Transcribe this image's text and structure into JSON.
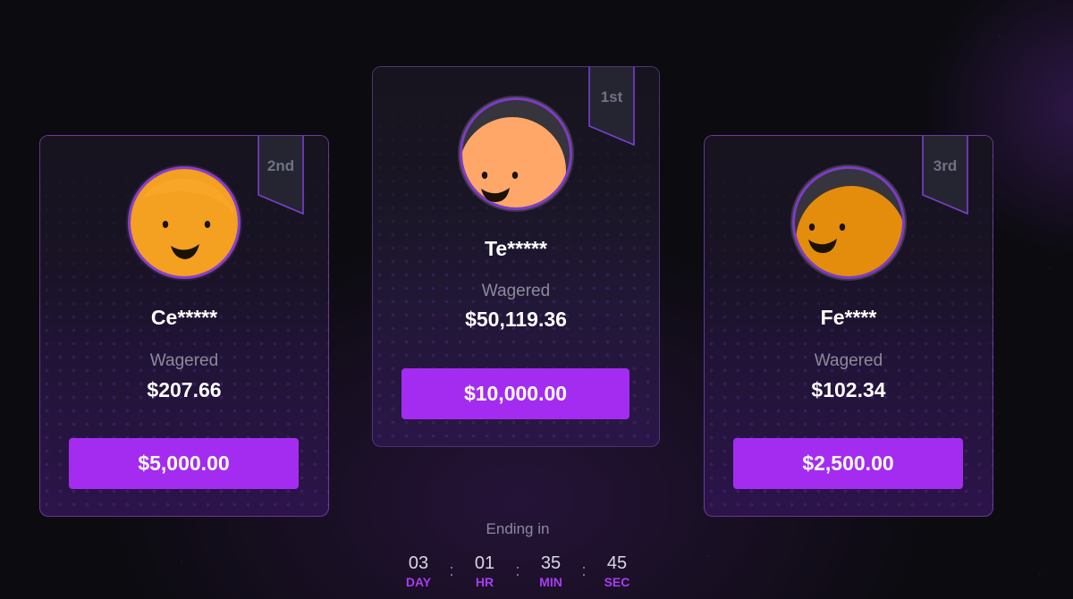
{
  "leaderboard": {
    "podium": [
      {
        "rank_label": "2nd",
        "player_name": "Ce*****",
        "wager_label": "Wagered",
        "wager_amount": "$207.66",
        "prize": "$5,000.00",
        "avatar_icon": "smiley-avatar-icon",
        "avatar_color": "#f4a020"
      },
      {
        "rank_label": "1st",
        "player_name": "Te*****",
        "wager_label": "Wagered",
        "wager_amount": "$50,119.36",
        "prize": "$10,000.00",
        "avatar_icon": "smiley-avatar-icon",
        "avatar_color": "#ffa768"
      },
      {
        "rank_label": "3rd",
        "player_name": "Fe****",
        "wager_label": "Wagered",
        "wager_amount": "$102.34",
        "prize": "$2,500.00",
        "avatar_icon": "smiley-avatar-icon",
        "avatar_color": "#e48d0c"
      }
    ]
  },
  "countdown": {
    "label": "Ending in",
    "units": [
      {
        "value": "03",
        "label": "DAY"
      },
      {
        "value": "01",
        "label": "HR"
      },
      {
        "value": "35",
        "label": "MIN"
      },
      {
        "value": "45",
        "label": "SEC"
      }
    ],
    "separator": ":"
  },
  "colors": {
    "accent": "#a42cf0",
    "background": "#0c0b10",
    "muted_text": "#8c8a9c"
  }
}
